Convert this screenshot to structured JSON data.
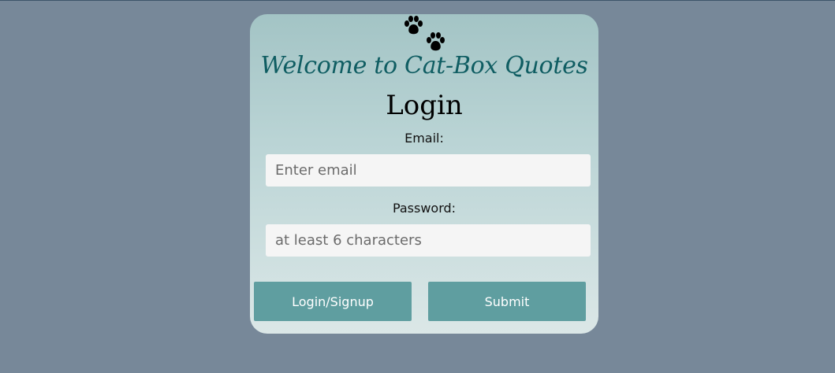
{
  "header": {
    "welcome_text": "Welcome to Cat-Box Quotes",
    "heading": "Login"
  },
  "icons": {
    "paw_top": "paw-print-icon",
    "paw_bottom": "paw-print-icon"
  },
  "form": {
    "email_label": "Email:",
    "email_placeholder": "Enter email",
    "password_label": "Password:",
    "password_placeholder": "at least 6 characters"
  },
  "buttons": {
    "login_signup": "Login/Signup",
    "submit": "Submit"
  },
  "colors": {
    "page_background": "#778899",
    "welcome_text": "#0f5d62",
    "button_background": "#5f9ea0",
    "button_text": "#ffffff",
    "input_background": "#f5f5f5"
  }
}
